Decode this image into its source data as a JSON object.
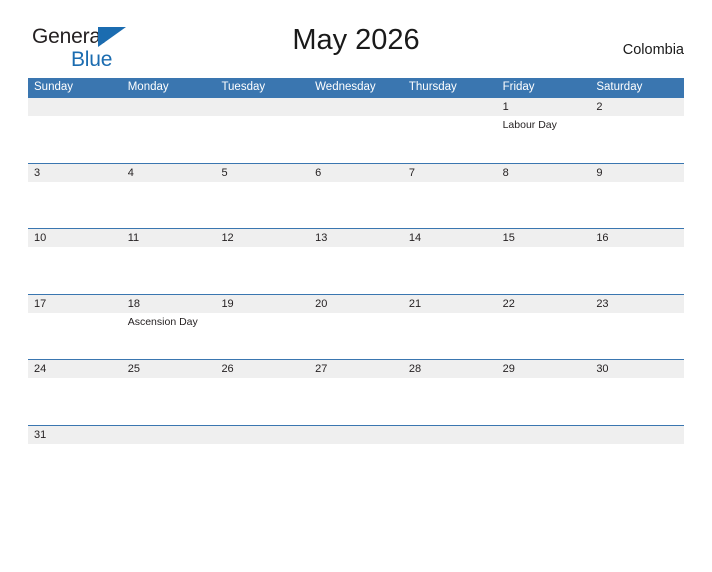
{
  "brand": {
    "name_part_one": "General",
    "name_part_two": "Blue",
    "flag_icon": "blue-triangle-flag",
    "color_dark": "#231f20",
    "color_blue": "#1b6cb0"
  },
  "header": {
    "title": "May 2026",
    "country": "Colombia"
  },
  "theme": {
    "header_blue": "#3a76b0",
    "row_line_blue": "#3a76b0",
    "date_band_gray": "#efefef",
    "text_dark": "#231f20",
    "page_background": "#ffffff"
  },
  "calendar": {
    "month": "May",
    "year": "2026",
    "weekday_headers": [
      "Sunday",
      "Monday",
      "Tuesday",
      "Wednesday",
      "Thursday",
      "Friday",
      "Saturday"
    ],
    "weeks": [
      {
        "days": [
          {
            "date": "",
            "event": ""
          },
          {
            "date": "",
            "event": ""
          },
          {
            "date": "",
            "event": ""
          },
          {
            "date": "",
            "event": ""
          },
          {
            "date": "",
            "event": ""
          },
          {
            "date": "1",
            "event": "Labour Day"
          },
          {
            "date": "2",
            "event": ""
          }
        ]
      },
      {
        "days": [
          {
            "date": "3",
            "event": ""
          },
          {
            "date": "4",
            "event": ""
          },
          {
            "date": "5",
            "event": ""
          },
          {
            "date": "6",
            "event": ""
          },
          {
            "date": "7",
            "event": ""
          },
          {
            "date": "8",
            "event": ""
          },
          {
            "date": "9",
            "event": ""
          }
        ]
      },
      {
        "days": [
          {
            "date": "10",
            "event": ""
          },
          {
            "date": "11",
            "event": ""
          },
          {
            "date": "12",
            "event": ""
          },
          {
            "date": "13",
            "event": ""
          },
          {
            "date": "14",
            "event": ""
          },
          {
            "date": "15",
            "event": ""
          },
          {
            "date": "16",
            "event": ""
          }
        ]
      },
      {
        "days": [
          {
            "date": "17",
            "event": ""
          },
          {
            "date": "18",
            "event": "Ascension Day"
          },
          {
            "date": "19",
            "event": ""
          },
          {
            "date": "20",
            "event": ""
          },
          {
            "date": "21",
            "event": ""
          },
          {
            "date": "22",
            "event": ""
          },
          {
            "date": "23",
            "event": ""
          }
        ]
      },
      {
        "days": [
          {
            "date": "24",
            "event": ""
          },
          {
            "date": "25",
            "event": ""
          },
          {
            "date": "26",
            "event": ""
          },
          {
            "date": "27",
            "event": ""
          },
          {
            "date": "28",
            "event": ""
          },
          {
            "date": "29",
            "event": ""
          },
          {
            "date": "30",
            "event": ""
          }
        ]
      },
      {
        "days": [
          {
            "date": "31",
            "event": ""
          },
          {
            "date": "",
            "event": ""
          },
          {
            "date": "",
            "event": ""
          },
          {
            "date": "",
            "event": ""
          },
          {
            "date": "",
            "event": ""
          },
          {
            "date": "",
            "event": ""
          },
          {
            "date": "",
            "event": ""
          }
        ]
      }
    ]
  }
}
